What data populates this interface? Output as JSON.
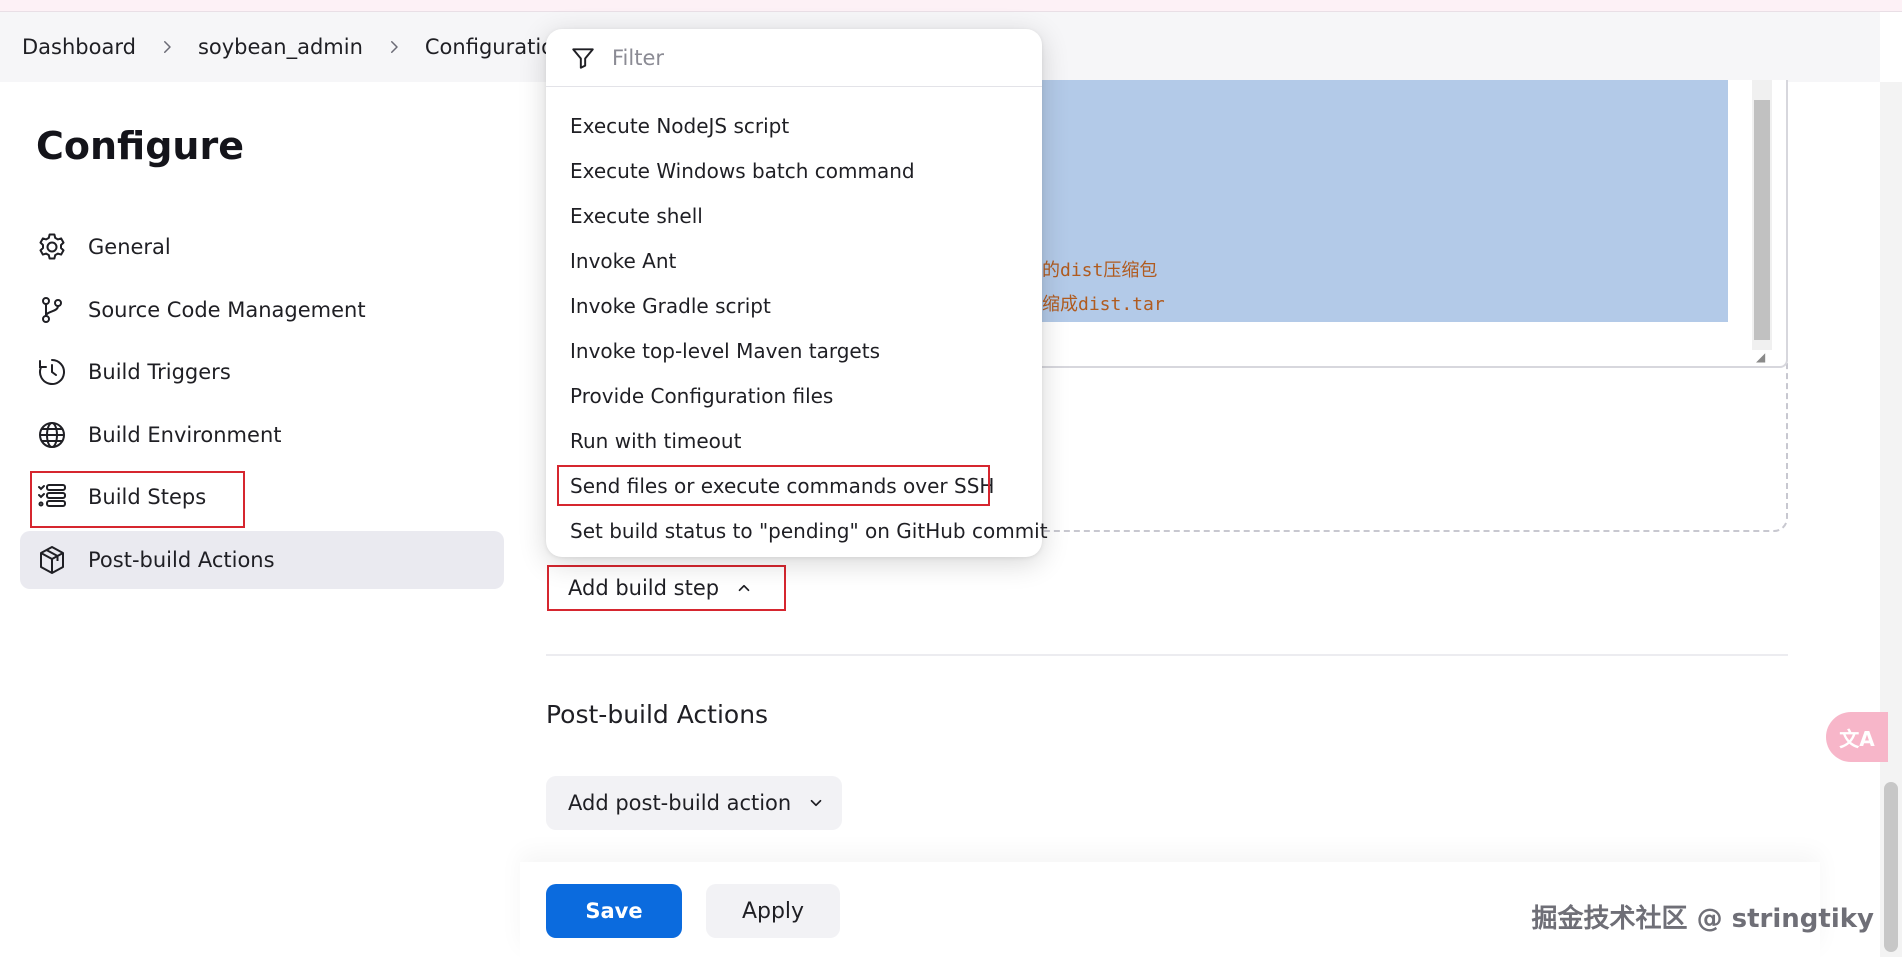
{
  "breadcrumb": {
    "items": [
      "Dashboard",
      "soybean_admin",
      "Configuration"
    ]
  },
  "page_title": "Configure",
  "sidebar": {
    "items": [
      {
        "label": "General",
        "icon": "gear-icon"
      },
      {
        "label": "Source Code Management",
        "icon": "branch-icon"
      },
      {
        "label": "Build Triggers",
        "icon": "clock-icon"
      },
      {
        "label": "Build Environment",
        "icon": "globe-icon"
      },
      {
        "label": "Build Steps",
        "icon": "list-icon"
      },
      {
        "label": "Post-build Actions",
        "icon": "package-icon"
      }
    ],
    "active_index": 5
  },
  "editor": {
    "lines": [
      "的dist压缩包",
      "缩成dist.tar"
    ]
  },
  "dropdown": {
    "filter_placeholder": "Filter",
    "items": [
      "Execute NodeJS script",
      "Execute Windows batch command",
      "Execute shell",
      "Invoke Ant",
      "Invoke Gradle script",
      "Invoke top-level Maven targets",
      "Provide Configuration files",
      "Run with timeout",
      "Send files or execute commands over SSH",
      "Set build status to \"pending\" on GitHub commit"
    ]
  },
  "build_steps": {
    "add_label": "Add build step"
  },
  "post_build": {
    "title": "Post-build Actions",
    "add_label": "Add post-build action"
  },
  "actions": {
    "save_label": "Save",
    "apply_label": "Apply"
  },
  "translate_fab": {
    "label": "文A"
  },
  "watermark": "掘金技术社区 @ stringtiky",
  "colors": {
    "primary": "#0b6bde",
    "highlight_box": "#d6262f",
    "selection": "#b3cae8",
    "code_text": "#b05b1f"
  }
}
